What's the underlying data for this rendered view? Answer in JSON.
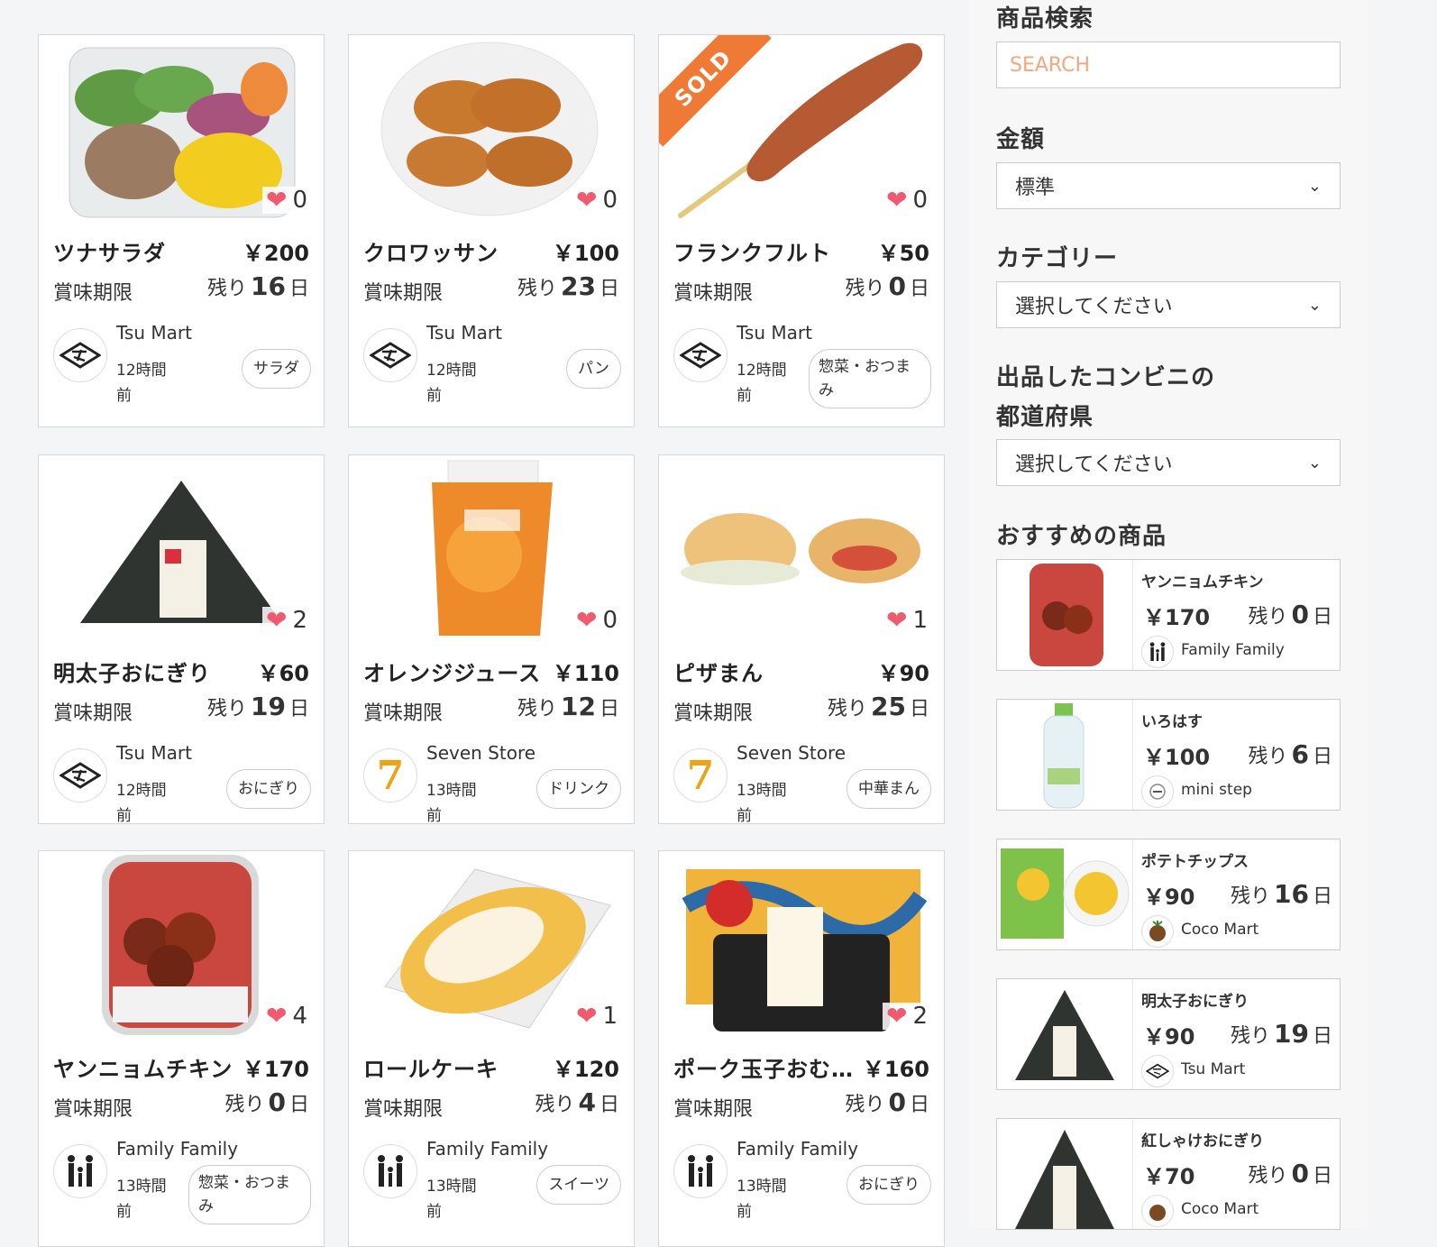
{
  "products": [
    {
      "name": "ツナサラダ",
      "price": "￥200",
      "expiry_label": "賞味期限",
      "rest_prefix": "残り",
      "days": "16",
      "rest_suffix": "日",
      "likes": "0",
      "store": "Tsu Mart",
      "ago": "12時間前",
      "category": "サラダ",
      "sold": false,
      "logo": "tsu-mart-logo",
      "image": "tuna-salad"
    },
    {
      "name": "クロワッサン",
      "price": "￥100",
      "expiry_label": "賞味期限",
      "rest_prefix": "残り",
      "days": "23",
      "rest_suffix": "日",
      "likes": "0",
      "store": "Tsu Mart",
      "ago": "12時間前",
      "category": "パン",
      "sold": false,
      "logo": "tsu-mart-logo",
      "image": "croissant"
    },
    {
      "name": "フランクフルト",
      "price": "￥50",
      "expiry_label": "賞味期限",
      "rest_prefix": "残り",
      "days": "0",
      "rest_suffix": "日",
      "likes": "0",
      "store": "Tsu Mart",
      "ago": "12時間前",
      "category": "惣菜・おつまみ",
      "sold": true,
      "sold_label": "SOLD",
      "logo": "tsu-mart-logo",
      "image": "frankfurt"
    },
    {
      "name": "明太子おにぎり",
      "price": "￥60",
      "expiry_label": "賞味期限",
      "rest_prefix": "残り",
      "days": "19",
      "rest_suffix": "日",
      "likes": "2",
      "store": "Tsu Mart",
      "ago": "12時間前",
      "category": "おにぎり",
      "sold": false,
      "logo": "tsu-mart-logo",
      "image": "onigiri"
    },
    {
      "name": "オレンジジュース",
      "price": "￥110",
      "expiry_label": "賞味期限",
      "rest_prefix": "残り",
      "days": "12",
      "rest_suffix": "日",
      "likes": "0",
      "store": "Seven Store",
      "ago": "13時間前",
      "category": "ドリンク",
      "sold": false,
      "logo": "seven-store-logo",
      "image": "orange-juice"
    },
    {
      "name": "ピザまん",
      "price": "￥90",
      "expiry_label": "賞味期限",
      "rest_prefix": "残り",
      "days": "25",
      "rest_suffix": "日",
      "likes": "1",
      "store": "Seven Store",
      "ago": "13時間前",
      "category": "中華まん",
      "sold": false,
      "logo": "seven-store-logo",
      "image": "pizza-bun"
    },
    {
      "name": "ヤンニョムチキン",
      "price": "￥170",
      "expiry_label": "賞味期限",
      "rest_prefix": "残り",
      "days": "0",
      "rest_suffix": "日",
      "likes": "4",
      "store": "Family Family",
      "ago": "13時間前",
      "category": "惣菜・おつまみ",
      "sold": false,
      "logo": "family-logo",
      "image": "yangnyeom-chicken"
    },
    {
      "name": "ロールケーキ",
      "price": "￥120",
      "expiry_label": "賞味期限",
      "rest_prefix": "残り",
      "days": "4",
      "rest_suffix": "日",
      "likes": "1",
      "store": "Family Family",
      "ago": "13時間前",
      "category": "スイーツ",
      "sold": false,
      "logo": "family-logo",
      "image": "roll-cake"
    },
    {
      "name": "ポーク玉子おむす...",
      "price": "￥160",
      "expiry_label": "賞味期限",
      "rest_prefix": "残り",
      "days": "0",
      "rest_suffix": "日",
      "likes": "2",
      "store": "Family Family",
      "ago": "13時間前",
      "category": "おにぎり",
      "sold": false,
      "logo": "family-logo",
      "image": "pork-egg-onigiri"
    }
  ],
  "sidebar": {
    "search_title": "商品検索",
    "search_placeholder": "SEARCH",
    "price_title": "金額",
    "price_value": "標準",
    "category_title": "カテゴリー",
    "category_value": "選択してください",
    "pref_title_1": "出品したコンビニの",
    "pref_title_2": "都道府県",
    "pref_value": "選択してください",
    "rec_title": "おすすめの商品"
  },
  "recommended": [
    {
      "name": "ヤンニョムチキン",
      "price": "￥170",
      "rest_prefix": "残り",
      "days": "0",
      "rest_suffix": "日",
      "store": "Family Family"
    },
    {
      "name": "いろはす",
      "price": "￥100",
      "rest_prefix": "残り",
      "days": "6",
      "rest_suffix": "日",
      "store": "mini step"
    },
    {
      "name": "ポテトチップス",
      "price": "￥90",
      "rest_prefix": "残り",
      "days": "16",
      "rest_suffix": "日",
      "store": "Coco Mart"
    },
    {
      "name": "明太子おにぎり",
      "price": "￥90",
      "rest_prefix": "残り",
      "days": "19",
      "rest_suffix": "日",
      "store": "Tsu Mart"
    },
    {
      "name": "紅しゃけおにぎり",
      "price": "￥70",
      "rest_prefix": "残り",
      "days": "0",
      "rest_suffix": "日",
      "store": "Coco Mart"
    }
  ],
  "colors": {
    "accent": "#f05a6e",
    "sold": "#ee7a35",
    "placeholder": "#f4a77e"
  }
}
